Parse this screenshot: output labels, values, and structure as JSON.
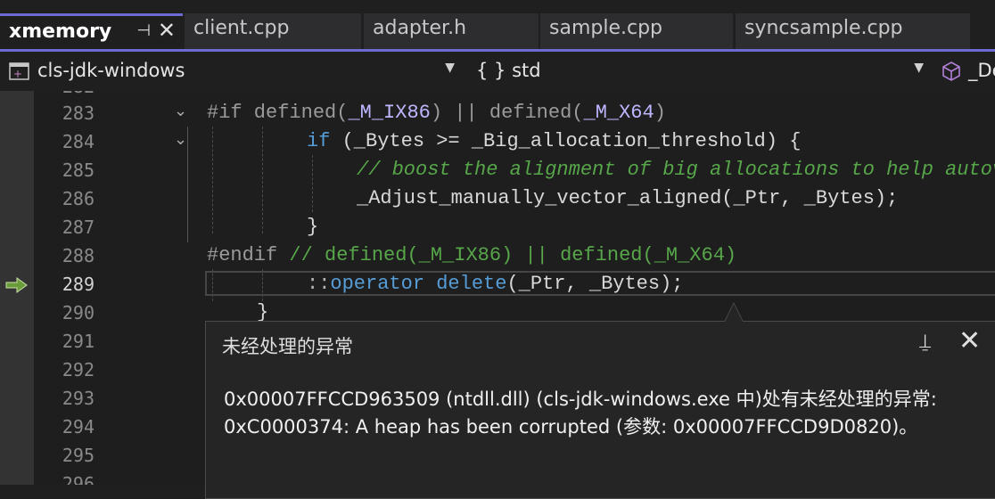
{
  "tabs": [
    {
      "label": "xmemory",
      "active": true
    },
    {
      "label": "client.cpp",
      "active": false
    },
    {
      "label": "adapter.h",
      "active": false
    },
    {
      "label": "sample.cpp",
      "active": false
    },
    {
      "label": "syncsample.cpp",
      "active": false
    }
  ],
  "nav": {
    "project": "cls-jdk-windows",
    "scope": "{ } std",
    "member": "_De"
  },
  "lines": [
    {
      "num": "282"
    },
    {
      "num": "283"
    },
    {
      "num": "284"
    },
    {
      "num": "285"
    },
    {
      "num": "286"
    },
    {
      "num": "287"
    },
    {
      "num": "288"
    },
    {
      "num": "289"
    },
    {
      "num": "290"
    },
    {
      "num": "291"
    },
    {
      "num": "292"
    },
    {
      "num": "293"
    },
    {
      "num": "294"
    },
    {
      "num": "295"
    },
    {
      "num": "296"
    }
  ],
  "code": {
    "l283_a": "#if defined(",
    "l283_b": "_M_IX86",
    "l283_c": ") || defined(",
    "l283_d": "_M_X64",
    "l283_e": ")",
    "l284_a": "if ",
    "l284_b": "(_Bytes >= _Big_allocation_threshold) {",
    "l285": "// boost the alignment of big allocations to help autovectorization",
    "l286": "_Adjust_manually_vector_aligned(_Ptr, _Bytes);",
    "l287": "}",
    "l288_a": "#endif",
    "l288_b": " // defined(_M_IX86) || defined(_M_X64)",
    "l289_a": "::",
    "l289_b": "operator delete",
    "l289_c": "(_Ptr, _Bytes);",
    "l290": "}"
  },
  "exception": {
    "title": "未经处理的异常",
    "line1": "0x00007FFCCD963509 (ntdll.dll) (cls-jdk-windows.exe 中)处有未经处理的异常:",
    "line2": "0xC0000374: A heap has been corrupted (参数: 0x00007FFCCD9D0820)。"
  }
}
